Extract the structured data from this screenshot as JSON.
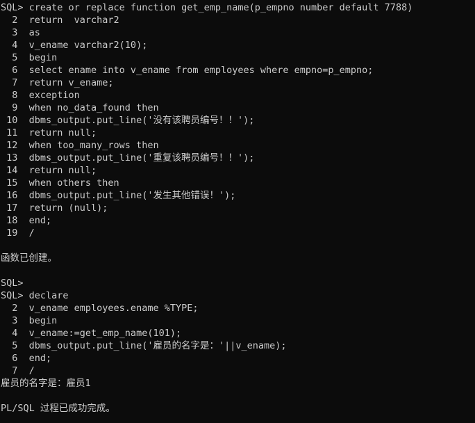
{
  "terminal": {
    "app": "SQL*Plus",
    "background_color": "#0c0c0c",
    "foreground_color": "#cccccc",
    "prompt": "SQL>",
    "continuation_marker": "/",
    "lines": [
      "SQL> create or replace function get_emp_name(p_empno number default 7788)",
      "  2  return  varchar2",
      "  3  as",
      "  4  v_ename varchar2(10);",
      "  5  begin",
      "  6  select ename into v_ename from employees where empno=p_empno;",
      "  7  return v_ename;",
      "  8  exception",
      "  9  when no_data_found then",
      " 10  dbms_output.put_line('没有该聘员编号！！');",
      " 11  return null;",
      " 12  when too_many_rows then",
      " 13  dbms_output.put_line('重复该聘员编号！！');",
      " 14  return null;",
      " 15  when others then",
      " 16  dbms_output.put_line('发生其他错误！');",
      " 17  return (null);",
      " 18  end;",
      " 19  /",
      "",
      "函数已创建。",
      "",
      "SQL>",
      "SQL> declare",
      "  2  v_ename employees.ename %TYPE;",
      "  3  begin",
      "  4  v_ename:=get_emp_name(101);",
      "  5  dbms_output.put_line('雇员的名字是：'||v_ename);",
      "  6  end;",
      "  7  /",
      "雇员的名字是：雇员1",
      "",
      "PL/SQL 过程已成功完成。"
    ]
  }
}
